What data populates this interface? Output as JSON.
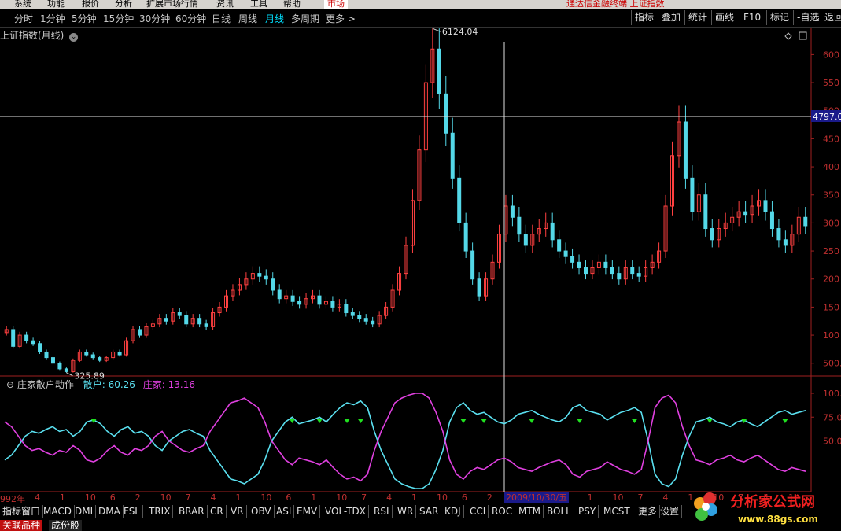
{
  "top_menu": {
    "items": [
      "系统",
      "功能",
      "报价",
      "分析",
      "扩展市场行情",
      "资讯",
      "工具",
      "帮助"
    ],
    "market_label": "市场",
    "title_text": "通达信金融终端 上证指数"
  },
  "period_bar": {
    "periods": [
      "分时",
      "1分钟",
      "5分钟",
      "15分钟",
      "30分钟",
      "60分钟",
      "日线",
      "周线",
      "月线",
      "多周期",
      "更多 >"
    ],
    "active_index": 8,
    "right_buttons": [
      "指标",
      "叠加",
      "统计",
      "画线",
      "F10",
      "标记",
      "-自选",
      "返回"
    ]
  },
  "main_chart": {
    "title": "上证指数(月线)",
    "peak_label": "6124.04",
    "low_label": "325.89",
    "cursor_price": "4797.0",
    "y_axis_labels": [
      "600",
      "550",
      "500",
      "450",
      "400",
      "350",
      "300",
      "250",
      "200",
      "150",
      "100",
      "500."
    ]
  },
  "indicator": {
    "name": "庄家散户动作",
    "retail_label": "散户: 60.26",
    "dealer_label": "庄家: 13.16",
    "y_axis_labels": [
      "100.",
      "75.0",
      "50.0"
    ],
    "retail_color": "#5ae0f0",
    "dealer_color": "#e040e0"
  },
  "date_bar": {
    "first_label": "992年",
    "ticks": [
      "4",
      "1",
      "10",
      "6",
      "2",
      "10",
      "7",
      "4",
      "1",
      "10",
      "6",
      "1",
      "10",
      "7",
      "4",
      "1",
      "10",
      "6",
      "2",
      "10",
      "7",
      "4",
      "1",
      "10",
      "7",
      "4",
      "1",
      "10",
      "7",
      "4",
      "1"
    ],
    "cursor_date": "2009/10/30/五"
  },
  "indicator_tabs": [
    "指标",
    "窗口",
    "MACD",
    "DMI",
    "DMA",
    "FSL",
    "TRIX",
    "BRAR",
    "CR",
    "VR",
    "OBV",
    "ASI",
    "EMV",
    "VOL-TDX",
    "RSI",
    "WR",
    "SAR",
    "KDJ",
    "CCI",
    "ROC",
    "MTM",
    "BOLL",
    "PSY",
    "MCST",
    "更多",
    "设置"
  ],
  "bottom_bar": {
    "related": "关联品种",
    "constituents": "成份股"
  },
  "watermark": {
    "brand": "分析家公式网",
    "url": "www.88gs.com"
  },
  "colors": {
    "up": "#ff4040",
    "down": "#54d8e8",
    "axis": "#a02020",
    "crosshair": "#e0e0e0"
  },
  "chart_data": {
    "type": "candlestick",
    "description_fields": "monthly Shanghai Composite index; closes sampled, indicator series values 0-100",
    "closes": [
      1100,
      800,
      1000,
      900,
      850,
      700,
      600,
      500,
      400,
      350,
      550,
      700,
      650,
      600,
      550,
      600,
      700,
      650,
      900,
      1100,
      1000,
      1150,
      1200,
      1300,
      1250,
      1400,
      1350,
      1200,
      1300,
      1200,
      1150,
      1400,
      1500,
      1700,
      1800,
      1900,
      2000,
      2100,
      2050,
      2000,
      1800,
      1650,
      1700,
      1600,
      1550,
      1650,
      1700,
      1550,
      1600,
      1500,
      1550,
      1400,
      1350,
      1300,
      1250,
      1200,
      1350,
      1500,
      1800,
      2100,
      2600,
      3400,
      4300,
      5500,
      6100,
      5300,
      4600,
      3800,
      3000,
      2500,
      2000,
      1700,
      2000,
      2300,
      2800,
      3300,
      3100,
      2800,
      2600,
      2800,
      2900,
      3000,
      2700,
      2500,
      2400,
      2300,
      2200,
      2100,
      2200,
      2300,
      2200,
      2100,
      2000,
      2200,
      2100,
      2050,
      2200,
      2300,
      2500,
      3300,
      4200,
      4800,
      3800,
      3200,
      3500,
      2900,
      2700,
      2900,
      3000,
      3100,
      3200,
      3150,
      3300,
      3400,
      3200,
      2900,
      2700,
      2600,
      2800,
      3100,
      2950
    ],
    "y_ticks": [
      500,
      1000,
      1500,
      2000,
      2500,
      3000,
      3500,
      4000,
      4500,
      5000,
      5500,
      6000
    ],
    "ylim": [
      300,
      6300
    ],
    "retail": [
      30,
      35,
      45,
      55,
      60,
      58,
      62,
      65,
      60,
      62,
      55,
      60,
      70,
      72,
      68,
      60,
      55,
      62,
      65,
      58,
      60,
      55,
      45,
      40,
      50,
      55,
      60,
      62,
      58,
      55,
      40,
      30,
      20,
      10,
      8,
      5,
      10,
      15,
      30,
      50,
      60,
      70,
      75,
      68,
      70,
      72,
      75,
      70,
      78,
      85,
      90,
      88,
      92,
      85,
      60,
      40,
      25,
      10,
      5,
      2,
      0,
      0,
      5,
      20,
      40,
      70,
      85,
      90,
      82,
      78,
      80,
      75,
      70,
      68,
      72,
      78,
      80,
      82,
      78,
      75,
      72,
      70,
      75,
      85,
      88,
      82,
      80,
      78,
      72,
      76,
      80,
      82,
      85,
      80,
      50,
      15,
      5,
      2,
      10,
      35,
      55,
      70,
      72,
      75,
      70,
      68,
      65,
      70,
      72,
      68,
      65,
      70,
      75,
      80,
      82,
      78,
      80,
      82
    ],
    "dealer": [
      70,
      65,
      55,
      45,
      40,
      42,
      38,
      35,
      40,
      38,
      45,
      40,
      30,
      28,
      32,
      40,
      45,
      38,
      35,
      42,
      40,
      45,
      55,
      60,
      50,
      45,
      40,
      38,
      42,
      45,
      60,
      70,
      80,
      90,
      92,
      95,
      90,
      85,
      70,
      50,
      40,
      30,
      25,
      32,
      30,
      28,
      25,
      30,
      22,
      15,
      10,
      12,
      8,
      15,
      40,
      60,
      75,
      90,
      95,
      98,
      100,
      100,
      95,
      80,
      60,
      30,
      15,
      10,
      18,
      22,
      20,
      25,
      30,
      32,
      28,
      22,
      20,
      18,
      22,
      25,
      28,
      30,
      25,
      15,
      12,
      18,
      20,
      22,
      28,
      24,
      20,
      18,
      15,
      20,
      50,
      85,
      95,
      98,
      90,
      65,
      45,
      30,
      28,
      25,
      30,
      32,
      35,
      30,
      28,
      32,
      35,
      30,
      25,
      20,
      18,
      22,
      20,
      18
    ]
  }
}
